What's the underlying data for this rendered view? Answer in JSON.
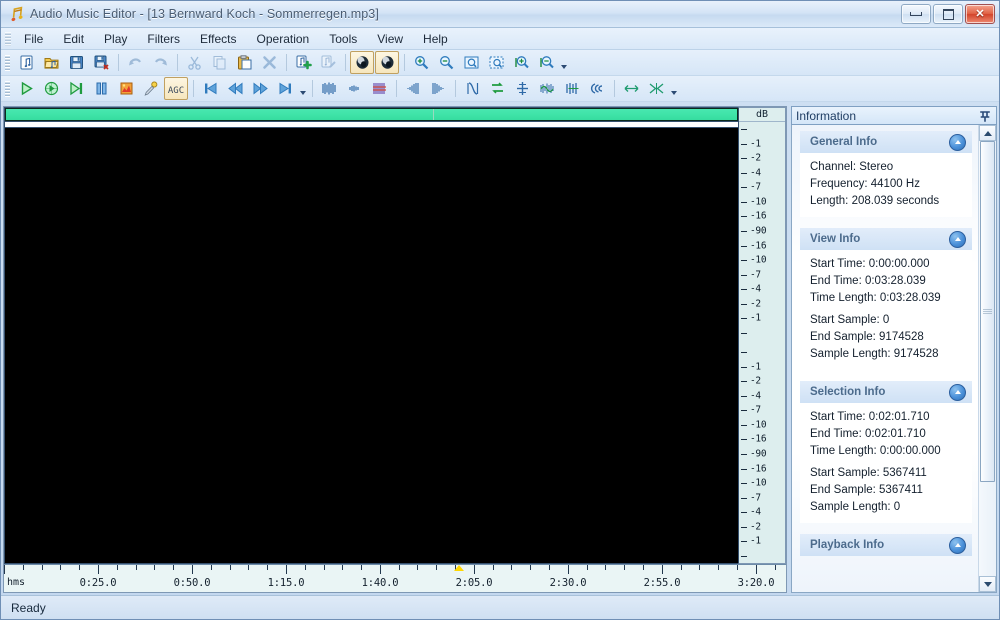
{
  "window": {
    "title": "Audio Music Editor - [13 Bernward Koch - Sommerregen.mp3]",
    "icon": "music-note-app-icon",
    "buttons": {
      "minimize": "minimize-button",
      "maximize": "maximize-button",
      "close": "close-button"
    }
  },
  "menubar": {
    "items": [
      {
        "label": "File",
        "accel": "F"
      },
      {
        "label": "Edit",
        "accel": "E"
      },
      {
        "label": "Play",
        "accel": "P"
      },
      {
        "label": "Filters",
        "accel": "t"
      },
      {
        "label": "Effects",
        "accel": "c"
      },
      {
        "label": "Operation",
        "accel": "O"
      },
      {
        "label": "Tools",
        "accel": "T"
      },
      {
        "label": "View",
        "accel": "V"
      },
      {
        "label": "Help",
        "accel": "H"
      }
    ]
  },
  "toolbar_top": {
    "items": [
      {
        "name": "new-file-icon",
        "state": "enabled"
      },
      {
        "name": "open-file-icon",
        "state": "enabled"
      },
      {
        "name": "save-icon",
        "state": "enabled"
      },
      {
        "name": "save-as-icon",
        "state": "enabled"
      },
      {
        "name": "separator"
      },
      {
        "name": "undo-icon",
        "state": "disabled"
      },
      {
        "name": "redo-icon",
        "state": "disabled"
      },
      {
        "name": "separator"
      },
      {
        "name": "cut-icon",
        "state": "disabled"
      },
      {
        "name": "copy-icon",
        "state": "disabled"
      },
      {
        "name": "paste-icon",
        "state": "enabled"
      },
      {
        "name": "delete-icon",
        "state": "disabled"
      },
      {
        "name": "separator"
      },
      {
        "name": "insert-file-icon",
        "state": "enabled"
      },
      {
        "name": "mix-paste-icon",
        "state": "disabled"
      },
      {
        "name": "separator"
      },
      {
        "name": "left-channel-icon",
        "state": "pressed"
      },
      {
        "name": "right-channel-icon",
        "state": "pressed"
      },
      {
        "name": "separator"
      },
      {
        "name": "zoom-in-icon",
        "state": "enabled"
      },
      {
        "name": "zoom-out-icon",
        "state": "enabled"
      },
      {
        "name": "zoom-full-icon",
        "state": "enabled"
      },
      {
        "name": "zoom-selection-icon",
        "state": "enabled"
      },
      {
        "name": "zoom-vertical-in-icon",
        "state": "enabled"
      },
      {
        "name": "zoom-vertical-out-icon",
        "state": "enabled"
      },
      {
        "name": "dropdown-arrow"
      }
    ]
  },
  "toolbar_bottom": {
    "items": [
      {
        "name": "play-icon",
        "state": "enabled"
      },
      {
        "name": "play-loop-icon",
        "state": "enabled"
      },
      {
        "name": "play-to-end-icon",
        "state": "enabled"
      },
      {
        "name": "pause-icon",
        "state": "enabled"
      },
      {
        "name": "stop-record-icon",
        "state": "enabled"
      },
      {
        "name": "record-mic-icon",
        "state": "enabled"
      },
      {
        "name": "agc-icon",
        "state": "pressed",
        "label": "AGC"
      },
      {
        "name": "separator"
      },
      {
        "name": "go-to-start-icon",
        "state": "enabled"
      },
      {
        "name": "rewind-icon",
        "state": "enabled"
      },
      {
        "name": "forward-icon",
        "state": "enabled"
      },
      {
        "name": "go-to-end-icon",
        "state": "enabled"
      },
      {
        "name": "dropdown-arrow"
      },
      {
        "name": "separator"
      },
      {
        "name": "waveform-view-icon",
        "state": "enabled"
      },
      {
        "name": "spectrum-view-icon",
        "state": "enabled"
      },
      {
        "name": "spectrogram-view-icon",
        "state": "enabled"
      },
      {
        "name": "separator"
      },
      {
        "name": "fade-in-icon",
        "state": "enabled"
      },
      {
        "name": "fade-out-icon",
        "state": "enabled"
      },
      {
        "name": "separator"
      },
      {
        "name": "normalize-icon",
        "state": "enabled"
      },
      {
        "name": "invert-icon",
        "state": "enabled"
      },
      {
        "name": "silence-icon",
        "state": "enabled"
      },
      {
        "name": "noise-reduction-icon",
        "state": "enabled"
      },
      {
        "name": "amplify-icon",
        "state": "enabled"
      },
      {
        "name": "echo-icon",
        "state": "enabled"
      },
      {
        "name": "separator"
      },
      {
        "name": "stretch-icon",
        "state": "enabled"
      },
      {
        "name": "shrink-icon",
        "state": "enabled"
      },
      {
        "name": "dropdown-arrow"
      }
    ]
  },
  "editor": {
    "db_scale_header": "dB",
    "db_labels": [
      "-1",
      "-2",
      "-4",
      "-7",
      "-10",
      "-16",
      "-90",
      "-16",
      "-10",
      "-7",
      "-4",
      "-2",
      "-1"
    ],
    "ruler": {
      "unit_label": "hms",
      "ticks": [
        "0:25.0",
        "0:50.0",
        "1:15.0",
        "1:40.0",
        "2:05.0",
        "2:30.0",
        "2:55.0",
        "3:20.0"
      ]
    },
    "cursor": {
      "time": "0:02:01.710",
      "position_ratio": 0.582
    },
    "waveform_color": "#3ce6a8",
    "background_color": "#000000"
  },
  "information_panel": {
    "title": "Information",
    "pin_icon": "pin-icon",
    "groups": [
      {
        "title": "General Info",
        "toggle": "collapse-toggle-icon",
        "rows": [
          "Channel: Stereo",
          "Frequency: 44100 Hz",
          "Length: 208.039 seconds"
        ]
      },
      {
        "title": "View Info",
        "toggle": "collapse-toggle-icon",
        "rows": [
          "Start Time: 0:00:00.000",
          "End Time: 0:03:28.039",
          "Time Length: 0:03:28.039"
        ],
        "rows2": [
          "Start Sample: 0",
          "End Sample: 9174528",
          "Sample Length: 9174528"
        ]
      },
      {
        "title": "Selection Info",
        "toggle": "collapse-toggle-icon",
        "rows": [
          "Start Time: 0:02:01.710",
          "End Time: 0:02:01.710",
          "Time Length: 0:00:00.000"
        ],
        "rows2": [
          "Start Sample: 5367411",
          "End Sample: 5367411",
          "Sample Length: 0"
        ]
      },
      {
        "title": "Playback Info",
        "toggle": "collapse-toggle-icon",
        "rows": [],
        "rows2": []
      }
    ]
  },
  "statusbar": {
    "text": "Ready"
  }
}
